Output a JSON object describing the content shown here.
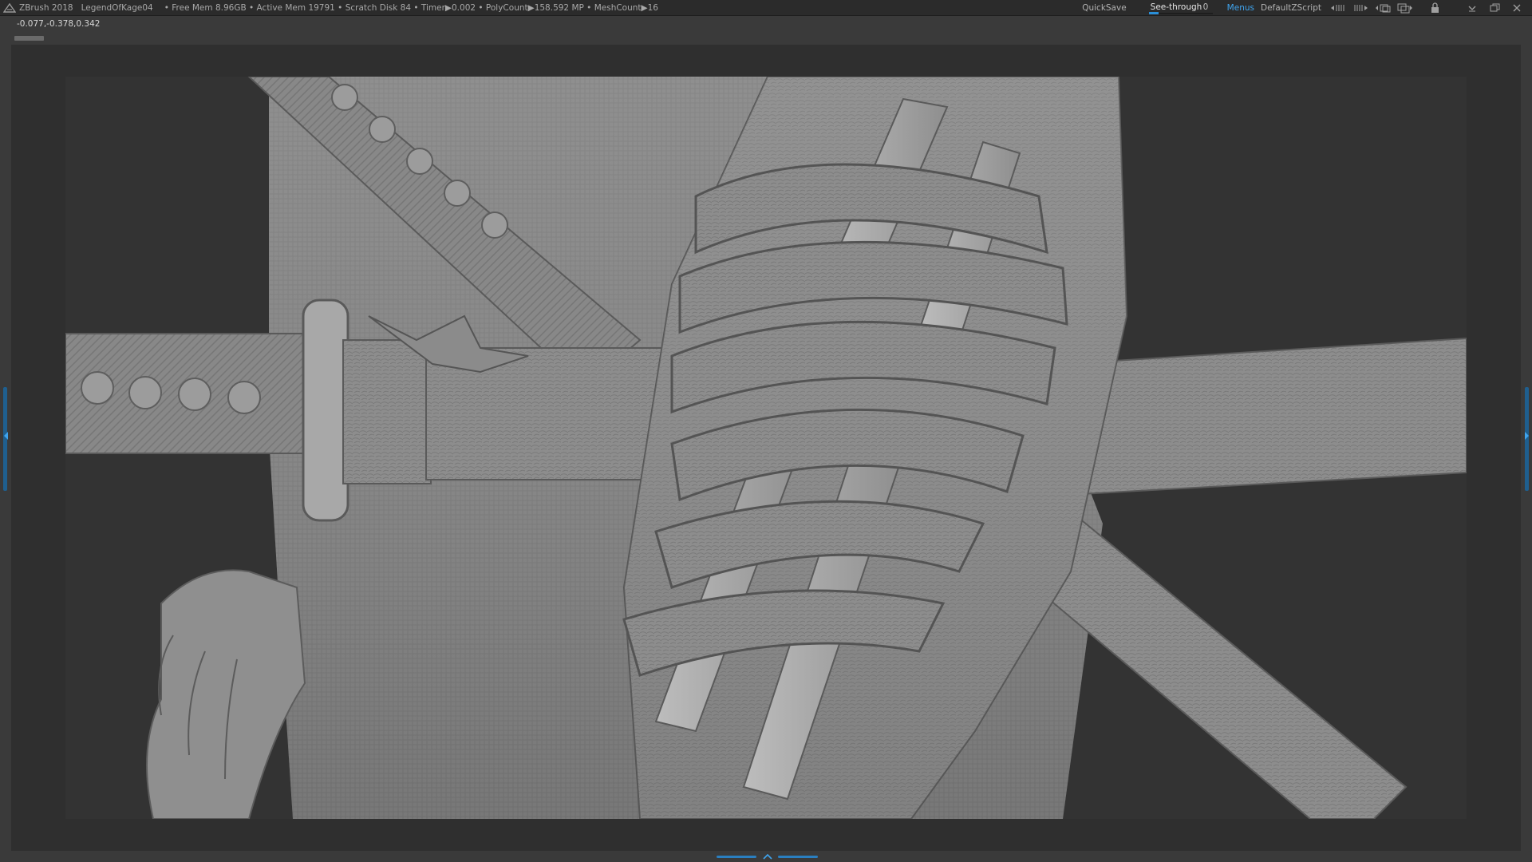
{
  "titlebar": {
    "app_name": "ZBrush 2018",
    "document_name": "LegendOfKage04",
    "info": "• Free Mem 8.96GB • Active Mem 19791 • Scratch Disk 84 • Timer▶0.002 • PolyCount▶158.592 MP • MeshCount▶16",
    "quicksave_label": "QuickSave",
    "seethrough": {
      "label": "See-through",
      "value": "0",
      "level": 0
    },
    "menus_label": "Menus",
    "script_label": "DefaultZScript",
    "icons": [
      "palette-slider-left-icon",
      "palette-slider-right-icon",
      "window-toggle-icon",
      "layout-icon",
      "lock-icon",
      "minimize-icon",
      "restore-icon",
      "close-icon"
    ]
  },
  "status": {
    "coordinates": "-0.077,-0.378,0.342"
  },
  "viewport": {
    "subject": "sculpt-render"
  },
  "colors": {
    "accent": "#2a8fd8",
    "menus_active": "#3fa4ee",
    "background": "#3a3a3a",
    "canvas": "#333333",
    "matcap": "#8a8a8a"
  }
}
